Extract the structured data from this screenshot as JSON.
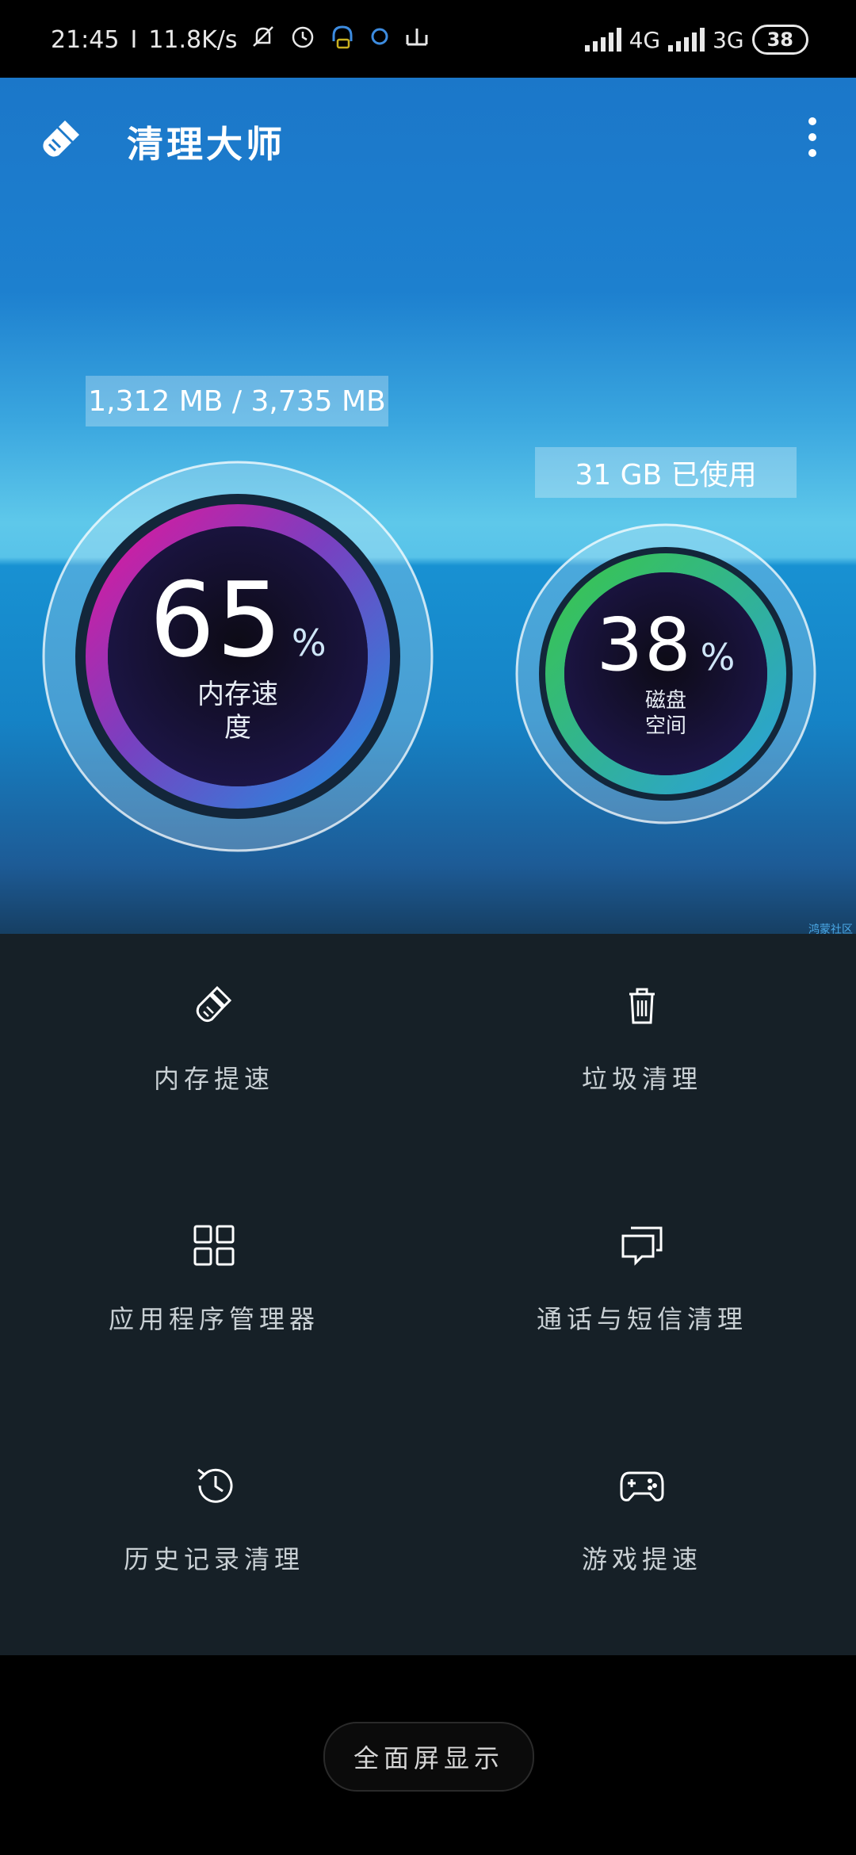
{
  "status_bar": {
    "time": "21:45",
    "speed": "11.8K/s",
    "net1": "4G",
    "net2": "3G",
    "battery": "38"
  },
  "header": {
    "title": "清理大师"
  },
  "memory": {
    "usage_label": "1,312 MB / 3,735 MB",
    "percent_value": "65",
    "percent_sign": "%",
    "label": "内存速度",
    "level": 0.65
  },
  "disk": {
    "usage_label": "31 GB 已使用",
    "percent_value": "38",
    "percent_sign": "%",
    "label": "磁盘空间",
    "level": 0.38
  },
  "menu": {
    "items": [
      {
        "label": "内存提速",
        "icon": "broom-icon"
      },
      {
        "label": "垃圾清理",
        "icon": "trash-icon"
      },
      {
        "label": "应用程序管理器",
        "icon": "grid-icon"
      },
      {
        "label": "通话与短信清理",
        "icon": "chat-icon"
      },
      {
        "label": "历史记录清理",
        "icon": "history-icon"
      },
      {
        "label": "游戏提速",
        "icon": "gamepad-icon"
      }
    ]
  },
  "bottom": {
    "fullscreen_label": "全面屏显示"
  },
  "watermark": "鸿蒙社区",
  "colors": {
    "hero_top": "#1b77c9",
    "menu_bg": "#162027",
    "memory_ring_start": "#e0179c",
    "memory_ring_end": "#1f8fe0",
    "disk_ring_start": "#39c64b",
    "disk_ring_end": "#2aa0dc"
  }
}
